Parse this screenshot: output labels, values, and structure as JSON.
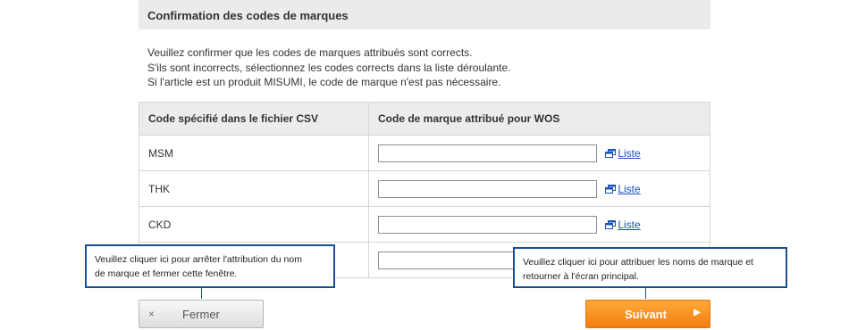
{
  "section": {
    "title": "Confirmation des codes de marques"
  },
  "intro": {
    "lines": [
      "Veuillez confirmer que les codes de marques attribués sont corrects.",
      "S'ils sont incorrects, sélectionnez les codes corrects dans la liste déroulante.",
      "Si l'article est un produit MISUMI, le code de marque n'est pas nécessaire."
    ]
  },
  "table": {
    "headers": [
      "Code spécifié dans le fichier CSV",
      "Code de marque attribué pour WOS"
    ],
    "rows": [
      {
        "code": "MSM",
        "assigned": "",
        "link": "Liste"
      },
      {
        "code": "THK",
        "assigned": "",
        "link": "Liste"
      },
      {
        "code": "CKD",
        "assigned": "",
        "link": "Liste"
      },
      {
        "code": "",
        "assigned": "",
        "link": ""
      }
    ]
  },
  "tooltips": {
    "close_help": [
      "Veuillez cliquer ici pour arrêter l'attribution du nom",
      "de marque et fermer cette fenêtre."
    ],
    "next_help": [
      "Veuillez cliquer ici pour attribuer les noms de marque et",
      "retourner à l'écran principal."
    ]
  },
  "buttons": {
    "close_icon": "×",
    "close_label": "Fermer",
    "next_label": "Suivant",
    "next_icon": "▶"
  },
  "colors": {
    "accent": "#f47e0e",
    "link": "#1a52b8",
    "tooltip_border": "#1b4f95"
  },
  "icons": {
    "liste": "new-window-icon",
    "close": "close-icon",
    "next": "play-arrow-icon"
  }
}
